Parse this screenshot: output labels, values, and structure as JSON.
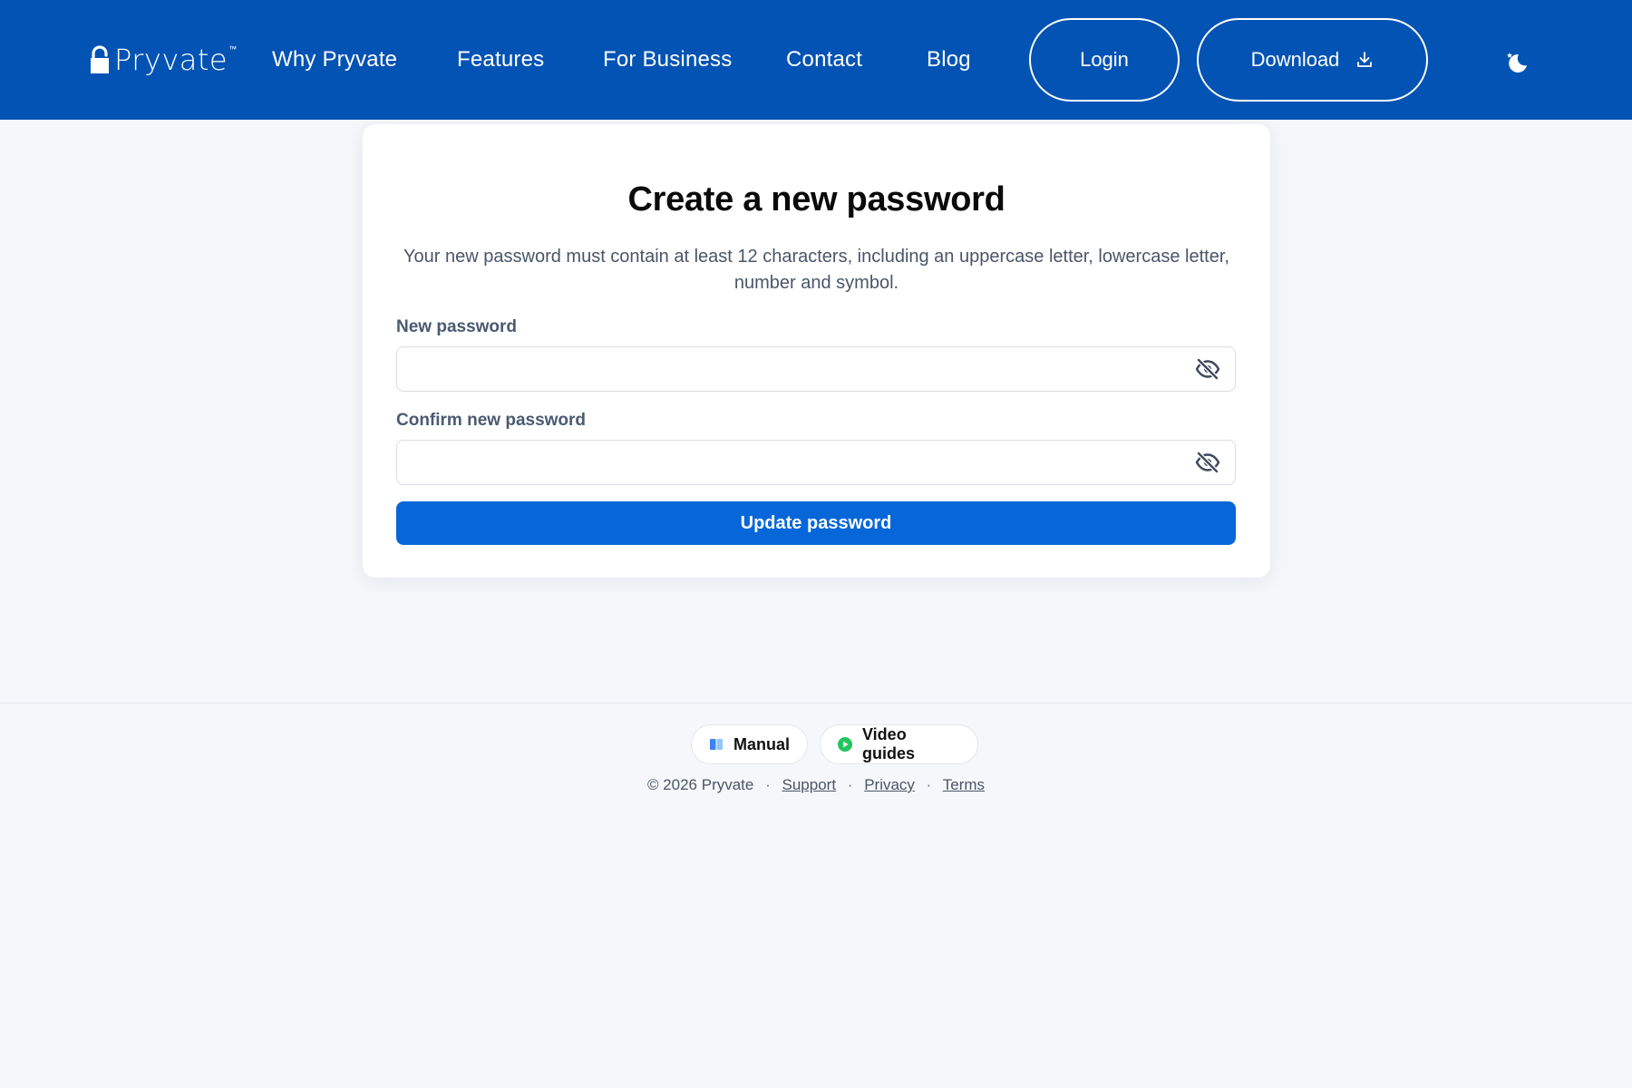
{
  "brand": {
    "name": "Pryvate",
    "tm": "™"
  },
  "nav": {
    "why": "Why Pryvate",
    "features": "Features",
    "business": "For Business",
    "contact": "Contact",
    "blog": "Blog"
  },
  "header_buttons": {
    "login": "Login",
    "download": "Download"
  },
  "icons": {
    "logo": "lock-icon",
    "download": "download-icon",
    "theme": "moon-stars-icon",
    "password_visibility": "eye-slash-icon",
    "manual": "book-icon",
    "video": "play-icon"
  },
  "card": {
    "title": "Create a new password",
    "description": "Your new password must contain at least 12 characters, including an uppercase letter, lowercase letter, number and symbol.",
    "new_password_label": "New password",
    "new_password_value": "",
    "confirm_password_label": "Confirm new password",
    "confirm_password_value": "",
    "submit_label": "Update password"
  },
  "footer": {
    "manual": "Manual",
    "video_guides": "Video guides",
    "copyright": "© 2026 Pryvate",
    "separator": "·",
    "support": "Support",
    "privacy": "Privacy",
    "terms": "Terms"
  },
  "colors": {
    "header_bg": "#0353b4",
    "primary_button": "#0767d9",
    "page_bg": "#f5f7fa",
    "video_icon": "#22c55e",
    "manual_icon": "#3b82f6"
  }
}
